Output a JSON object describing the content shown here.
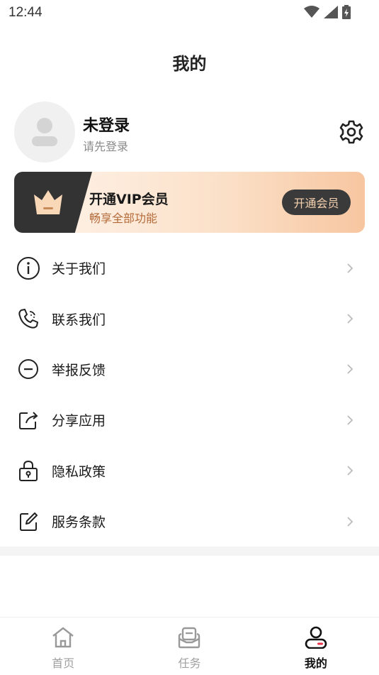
{
  "status_bar": {
    "time": "12:44"
  },
  "header": {
    "title": "我的"
  },
  "profile": {
    "name": "未登录",
    "subtitle": "请先登录"
  },
  "vip": {
    "title": "开通VIP会员",
    "subtitle": "畅享全部功能",
    "button_label": "开通会员"
  },
  "menu": {
    "items": [
      {
        "label": "关于我们",
        "icon": "info-icon"
      },
      {
        "label": "联系我们",
        "icon": "phone-icon"
      },
      {
        "label": "举报反馈",
        "icon": "minus-circle-icon"
      },
      {
        "label": "分享应用",
        "icon": "share-icon"
      },
      {
        "label": "隐私政策",
        "icon": "lock-icon"
      },
      {
        "label": "服务条款",
        "icon": "edit-icon"
      }
    ]
  },
  "tabbar": {
    "items": [
      {
        "label": "首页",
        "icon": "home-icon",
        "active": false
      },
      {
        "label": "任务",
        "icon": "task-icon",
        "active": false
      },
      {
        "label": "我的",
        "icon": "user-icon",
        "active": true
      }
    ]
  },
  "colors": {
    "accent_dark": "#333333",
    "vip_gold": "#f7c6a0",
    "vip_text": "#b36b3a",
    "tab_active_dot": "#e8334a"
  }
}
